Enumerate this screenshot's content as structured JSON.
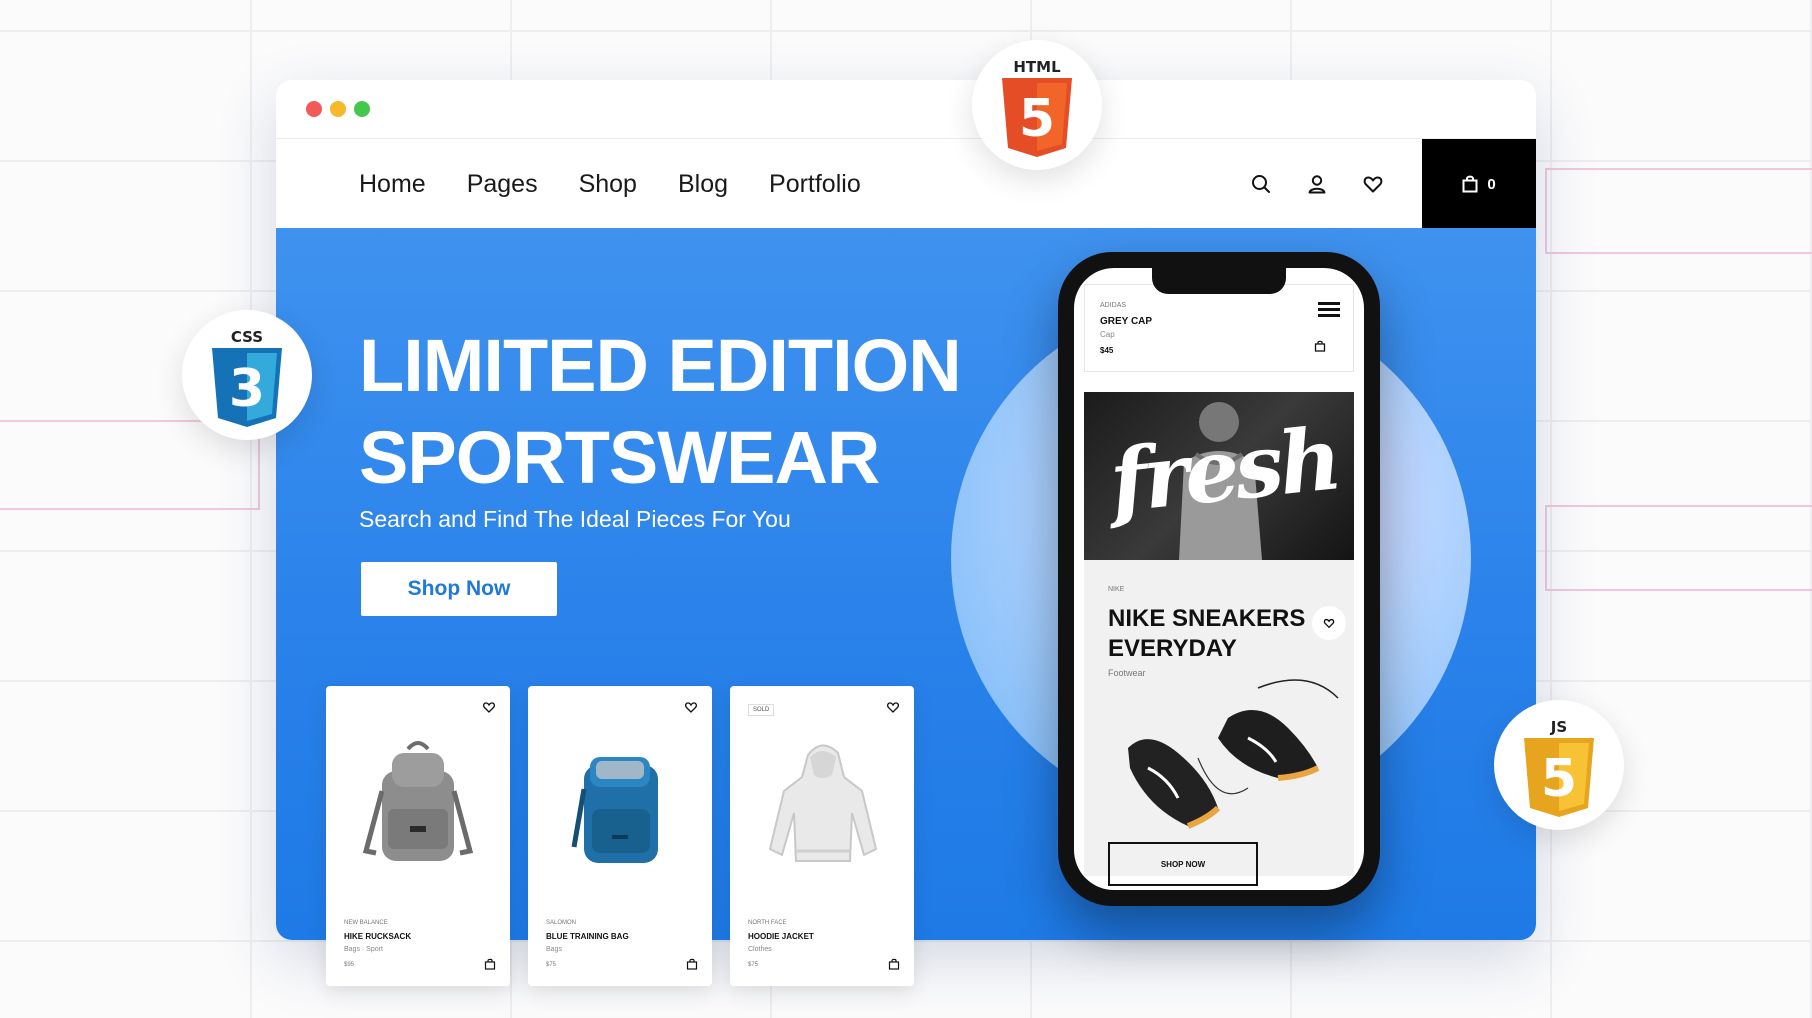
{
  "nav": {
    "links": [
      "Home",
      "Pages",
      "Shop",
      "Blog",
      "Portfolio"
    ],
    "cart_count": "0"
  },
  "hero": {
    "title_line1": "LIMITED EDITION",
    "title_line2": "SPORTSWEAR",
    "subtitle": "Search and Find The Ideal Pieces For You",
    "button": "Shop Now"
  },
  "cards": [
    {
      "brand": "NEW BALANCE",
      "name": "HIKE RUCKSACK",
      "category": "Bags · Sport",
      "price": "$95",
      "badge": "",
      "icon": "backpack-grey"
    },
    {
      "brand": "SALOMON",
      "name": "BLUE TRAINING BAG",
      "category": "Bags",
      "price": "$75",
      "badge": "",
      "icon": "backpack-blue"
    },
    {
      "brand": "NORTH FACE",
      "name": "HOODIE JACKET",
      "category": "Clothes",
      "price": "$75",
      "badge": "SOLD",
      "icon": "hoodie"
    }
  ],
  "phone": {
    "brand": "ADIDAS",
    "product": "GREY CAP",
    "category": "Cap",
    "price": "$45",
    "banner_text": "fresh",
    "feature_brand": "NIKE",
    "feature_title_line1": "NIKE SNEAKERS",
    "feature_title_line2": "EVERYDAY",
    "feature_category": "Footwear",
    "feature_button": "SHOP NOW"
  },
  "badges": {
    "html": "HTML",
    "html_digit": "5",
    "css": "CSS",
    "css_digit": "3",
    "js": "JS",
    "js_digit": "5"
  },
  "colors": {
    "hero_blue": "#2a82ea",
    "html_orange": "#e44d26",
    "css_blue": "#2965f1",
    "js_yellow": "#f0b323"
  }
}
